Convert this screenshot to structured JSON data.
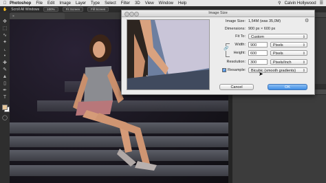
{
  "menubar": {
    "app_name": "Photoshop",
    "items": [
      "File",
      "Edit",
      "Image",
      "Layer",
      "Type",
      "Select",
      "Filter",
      "3D",
      "View",
      "Window",
      "Help"
    ],
    "user": "Calvin Hollywood"
  },
  "options": {
    "label": "Scroll All Windows",
    "btn1": "100%",
    "btn2": "Fit Screen",
    "btn3": "Fill Screen"
  },
  "dialog": {
    "title": "Image Size",
    "image_size_label": "Image Size:",
    "image_size_value": "1,54M (was 35,0M)",
    "dimensions_label": "Dimensions:",
    "dimensions_value": "900 px × 600 px",
    "fit_to_label": "Fit To:",
    "fit_to_value": "Custom",
    "width_label": "Width:",
    "width_value": "900",
    "width_unit": "Pixels",
    "height_label": "Height:",
    "height_value": "600",
    "height_unit": "Pixels",
    "resolution_label": "Resolution:",
    "resolution_value": "300",
    "resolution_unit": "Pixels/Inch",
    "resample_label": "Resample:",
    "resample_checked": true,
    "resample_value": "Bicubic (smooth gradients)",
    "cancel_label": "Cancel",
    "ok_label": "OK"
  },
  "colors": {
    "foreground": "#e9c99b",
    "background": "#ffffff",
    "ok_button": "#3f8ee6"
  }
}
